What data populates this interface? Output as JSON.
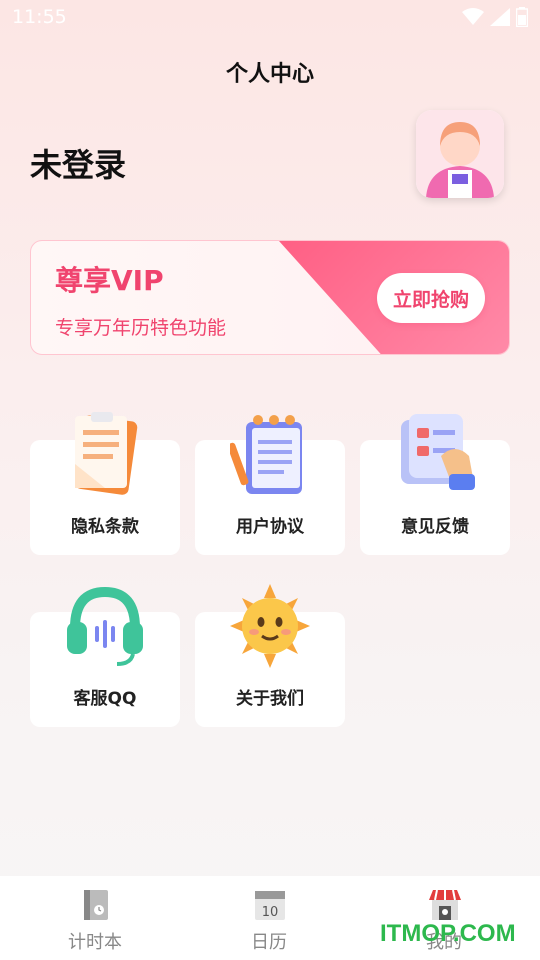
{
  "status": {
    "time": "11:55"
  },
  "header": {
    "title": "个人中心"
  },
  "profile": {
    "login_text": "未登录"
  },
  "vip": {
    "title": "尊享VIP",
    "subtitle": "专享万年历特色功能",
    "button_label": "立即抢购",
    "accent_color": "#f0446e"
  },
  "menu": {
    "items": [
      {
        "label": "隐私条款",
        "icon": "clipboard-icon"
      },
      {
        "label": "用户协议",
        "icon": "notebook-icon"
      },
      {
        "label": "意见反馈",
        "icon": "feedback-form-icon"
      },
      {
        "label": "客服QQ",
        "icon": "headset-icon"
      },
      {
        "label": "关于我们",
        "icon": "smiling-sun-icon"
      }
    ]
  },
  "tabbar": {
    "items": [
      {
        "label": "计时本",
        "icon": "timer-book-icon"
      },
      {
        "label": "日历",
        "icon": "calendar-icon",
        "calendar_number": "10"
      },
      {
        "label": "我的",
        "icon": "store-icon"
      }
    ]
  },
  "watermark": "ITMOP.COM"
}
